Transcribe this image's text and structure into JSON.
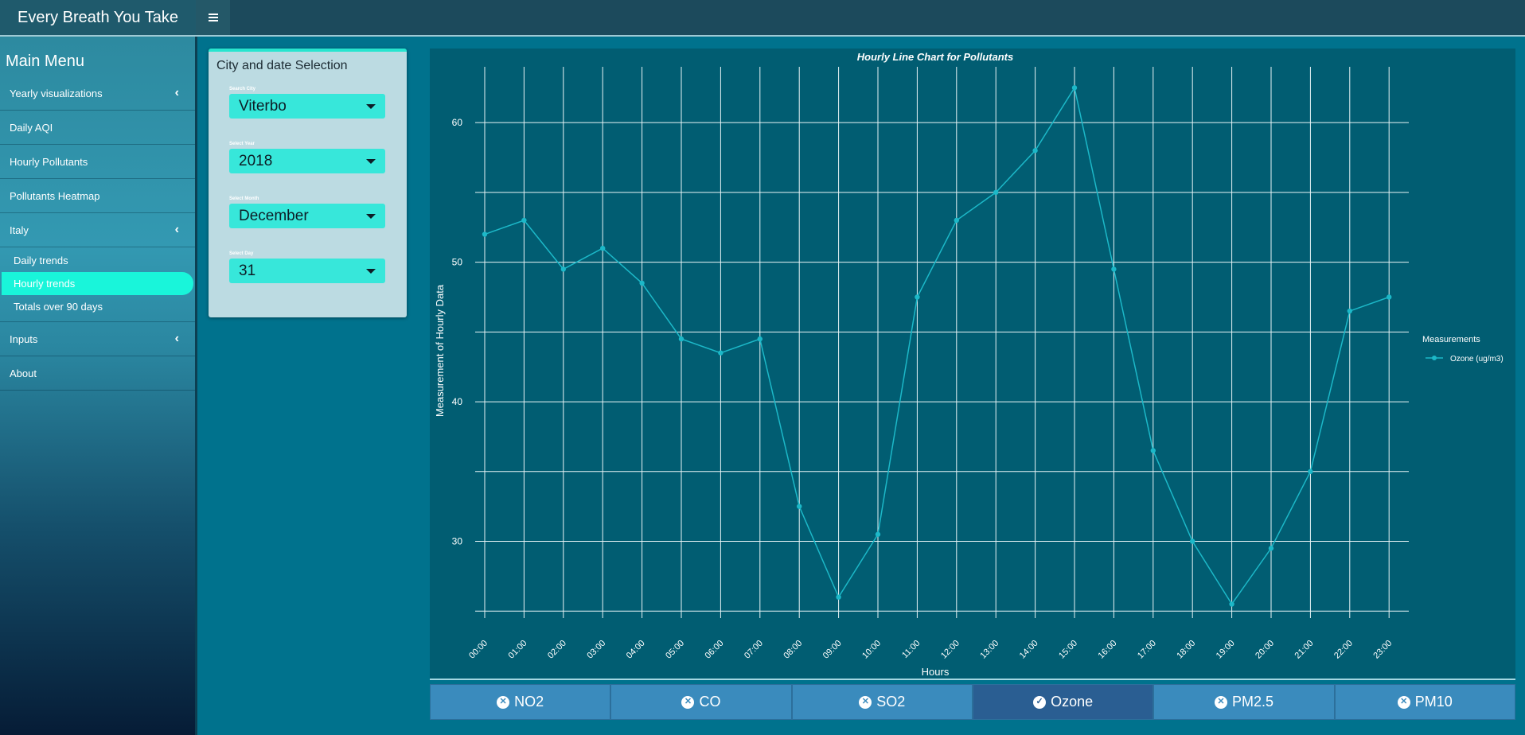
{
  "header": {
    "app_title": "Every Breath You Take"
  },
  "sidebar": {
    "menu_title": "Main Menu",
    "items": [
      {
        "label": "Yearly visualizations",
        "chevron": true
      },
      {
        "label": "Daily AQI",
        "chevron": false
      },
      {
        "label": "Hourly Pollutants",
        "chevron": false
      },
      {
        "label": "Pollutants Heatmap",
        "chevron": false
      },
      {
        "label": "Italy",
        "chevron": true
      }
    ],
    "italy_sub": [
      "Daily trends",
      "Hourly trends",
      "Totals over 90 days"
    ],
    "active_sub": "Hourly trends",
    "items_after": [
      {
        "label": "Inputs",
        "chevron": true
      },
      {
        "label": "About",
        "chevron": false
      }
    ]
  },
  "selection": {
    "title": "City and date Selection",
    "city_label": "Search City",
    "city": "Viterbo",
    "year_label": "Select Year",
    "year": "2018",
    "month_label": "Select Month",
    "month": "December",
    "day_label": "Select Day",
    "day": "31"
  },
  "chart_data": {
    "type": "line",
    "title": "Hourly Line Chart for Pollutants",
    "xlabel": "Hours",
    "ylabel": "Measurement of Hourly Data",
    "categories": [
      "00:00",
      "01:00",
      "02:00",
      "03:00",
      "04:00",
      "05:00",
      "06:00",
      "07:00",
      "08:00",
      "09:00",
      "10:00",
      "11:00",
      "12:00",
      "13:00",
      "14:00",
      "15:00",
      "16:00",
      "17:00",
      "18:00",
      "19:00",
      "20:00",
      "21:00",
      "22:00",
      "23:00"
    ],
    "series": [
      {
        "name": "Ozone (ug/m3)",
        "values": [
          52,
          53,
          49.5,
          51,
          48.5,
          44.5,
          43.5,
          44.5,
          32.5,
          26,
          30.5,
          47.5,
          53,
          55,
          58,
          62.5,
          49.5,
          36.5,
          30,
          25.5,
          29.5,
          35,
          46.5,
          47.5
        ]
      }
    ],
    "yticks": [
      30,
      40,
      50,
      60
    ],
    "ylim": [
      24.5,
      64
    ],
    "legend_title": "Measurements",
    "legend_position": "right",
    "grid": true,
    "colors": {
      "line": "#1cb8c8",
      "grid": "#e8f4f6",
      "background": "#015d72"
    }
  },
  "pollutant_buttons": [
    {
      "label": "NO2",
      "icon": "times-circle-icon",
      "active": false
    },
    {
      "label": "CO",
      "icon": "times-circle-icon",
      "active": false
    },
    {
      "label": "SO2",
      "icon": "times-circle-icon",
      "active": false
    },
    {
      "label": "Ozone",
      "icon": "check-circle-icon",
      "active": true
    },
    {
      "label": "PM2.5",
      "icon": "times-circle-icon",
      "active": false
    },
    {
      "label": "PM10",
      "icon": "times-circle-icon",
      "active": false
    }
  ]
}
